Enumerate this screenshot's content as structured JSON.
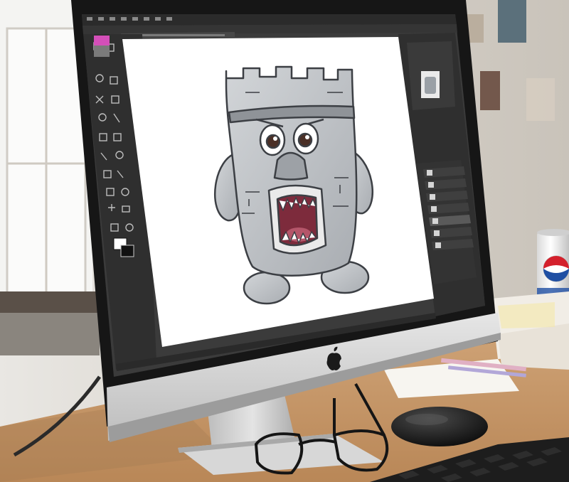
{
  "scene": {
    "description_tag": "photo-imac-photoshop",
    "colors": {
      "wall": "#d9d4cc",
      "desk": "#c79a6e",
      "monitor_frame": "#141414",
      "chin": "#dcdcdc",
      "app_bg": "#3a3a3a",
      "panel": "#2e2e2e",
      "canvas": "#ffffff",
      "character_grey": "#c2c6ca",
      "mouth": "#7d2b3c"
    }
  },
  "app": {
    "name": "image-editor",
    "menu_items": [
      "",
      "",
      "",
      "",
      "",
      "",
      "",
      "",
      ""
    ],
    "tab_title": "",
    "status_text": ""
  },
  "layers": [
    {
      "name": "",
      "visible": true
    },
    {
      "name": "",
      "visible": true
    },
    {
      "name": "",
      "visible": true
    },
    {
      "name": "",
      "visible": true
    },
    {
      "name": "",
      "visible": true
    },
    {
      "name": "",
      "visible": true,
      "selected": true
    },
    {
      "name": "",
      "visible": true
    }
  ],
  "tools": [
    "move",
    "marquee",
    "lasso",
    "quick-select",
    "crop",
    "eyedropper",
    "heal",
    "brush",
    "clone",
    "history-brush",
    "eraser",
    "gradient",
    "blur",
    "dodge",
    "pen",
    "type",
    "path-select",
    "shape",
    "hand",
    "zoom"
  ],
  "props": {
    "monitor_logo": "apple-logo",
    "can": "soda-can",
    "glasses": "eyeglasses",
    "mouse": "mouse",
    "keyboard": "keyboard"
  }
}
